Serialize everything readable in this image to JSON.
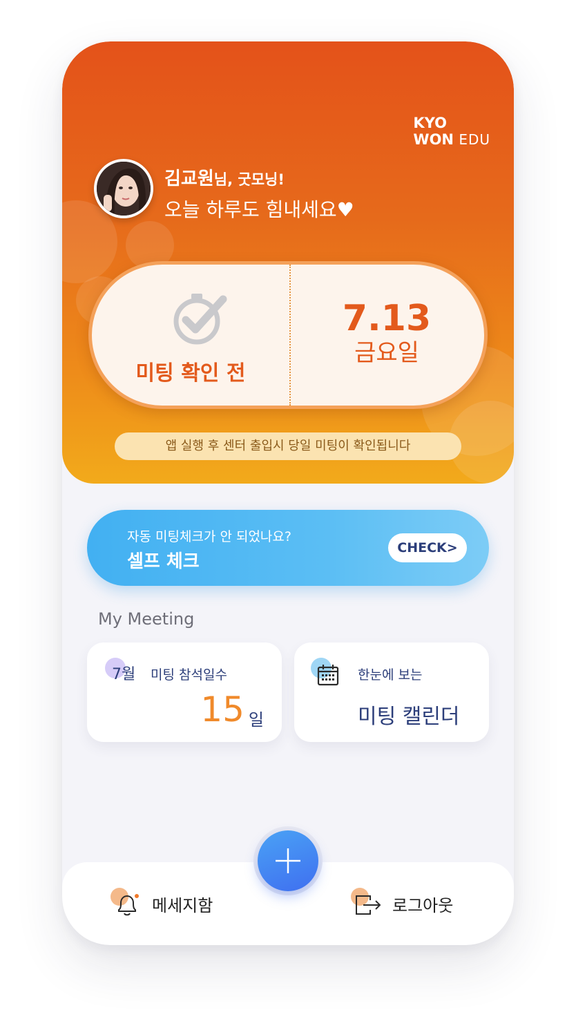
{
  "brand": {
    "line1": "KYO",
    "line2": "WON",
    "line3": "EDU"
  },
  "greeting": {
    "name": "김교원",
    "suffix": "님, 굿모닝!",
    "message": "오늘 하루도 힘내세요♥"
  },
  "meeting_status": {
    "label": "미팅 확인 전",
    "date": "7.13",
    "weekday": "금요일",
    "notice": "앱 실행 후 센터 출입시 당일 미팅이 확인됩니다"
  },
  "self_check": {
    "question": "자동 미팅체크가 안 되었나요?",
    "title": "셀프 체크",
    "button": "CHECK>"
  },
  "my_meeting": {
    "section_title": "My Meeting",
    "attendance": {
      "month": "7월",
      "label": "미팅 참석일수",
      "count": "15",
      "unit": "일"
    },
    "calendar": {
      "subtitle": "한눈에 보는",
      "title": "미팅 캘린더"
    }
  },
  "bottom_nav": {
    "messages": "메세지함",
    "logout": "로그아웃"
  },
  "colors": {
    "header_top": "#e4521a",
    "header_bottom": "#f2aa1b",
    "accent_orange": "#e35a1c",
    "self_check_blue": "#42b0f2",
    "navy_text": "#2c3e7a",
    "fab_blue": "#3f6ff0"
  },
  "icons": {
    "check": "check-circle-icon",
    "calendar": "calendar-icon",
    "bell": "bell-icon",
    "logout": "logout-icon",
    "plus": "plus-icon"
  }
}
